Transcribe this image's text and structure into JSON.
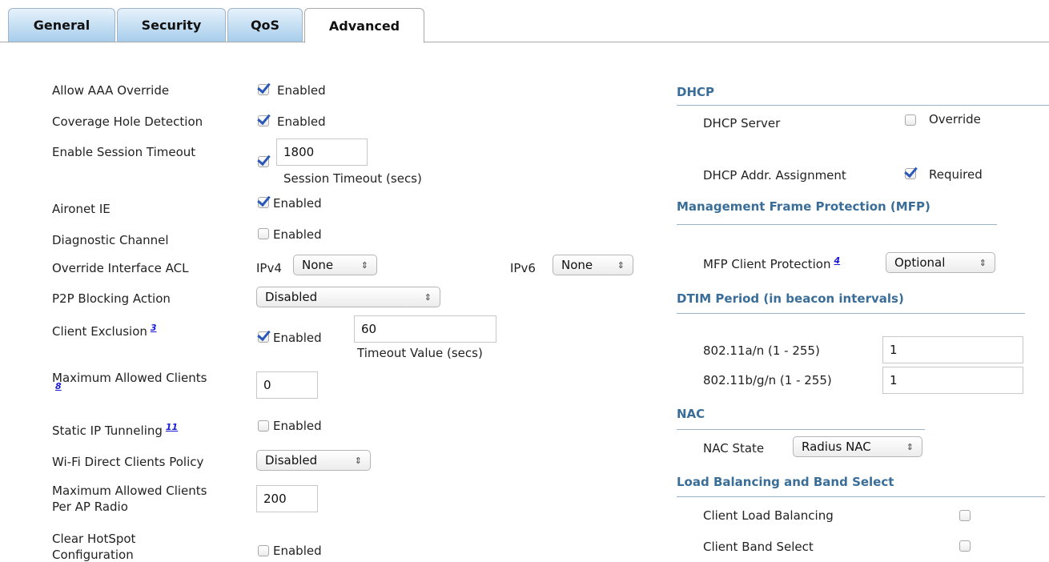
{
  "tabs": [
    {
      "label": "General"
    },
    {
      "label": "Security"
    },
    {
      "label": "QoS"
    },
    {
      "label": "Advanced"
    }
  ],
  "left": {
    "allow_aaa": {
      "label": "Allow AAA Override",
      "checked": true,
      "text": "Enabled"
    },
    "coverage_hole": {
      "label": "Coverage Hole Detection",
      "checked": true,
      "text": "Enabled"
    },
    "session_timeout": {
      "label": "Enable Session Timeout",
      "checked": true,
      "value": "1800",
      "caption": "Session Timeout (secs)"
    },
    "aironet": {
      "label": "Aironet IE",
      "checked": true,
      "text": "Enabled"
    },
    "diagnostic": {
      "label": "Diagnostic Channel",
      "checked": false,
      "text": "Enabled"
    },
    "override_acl": {
      "label": "Override Interface ACL",
      "ipv4_label": "IPv4",
      "ipv4_value": "None",
      "ipv6_label": "IPv6",
      "ipv6_value": "None"
    },
    "p2p": {
      "label": "P2P Blocking Action",
      "value": "Disabled"
    },
    "client_exclusion": {
      "label": "Client Exclusion",
      "footnote": "3",
      "checked": true,
      "text": "Enabled",
      "value": "60",
      "caption": "Timeout Value (secs)"
    },
    "max_clients": {
      "label_line1": "Maximum Allowed Clients",
      "footnote": "8",
      "value": "0"
    },
    "static_ip": {
      "label": "Static IP Tunneling",
      "footnote": "11",
      "checked": false,
      "text": "Enabled"
    },
    "wifi_direct": {
      "label": "Wi-Fi Direct Clients Policy",
      "value": "Disabled"
    },
    "max_per_radio": {
      "label_line1": "Maximum Allowed Clients",
      "label_line2": "Per AP Radio",
      "value": "200"
    },
    "hotspot": {
      "label_line1": "Clear HotSpot",
      "label_line2": "Configuration",
      "checked": false,
      "text": "Enabled"
    }
  },
  "right": {
    "dhcp": {
      "title": "DHCP",
      "server_label": "DHCP Server",
      "server_checked": false,
      "server_text": "Override",
      "assign_label": "DHCP Addr. Assignment",
      "assign_checked": true,
      "assign_text": "Required"
    },
    "mfp": {
      "title": "Management Frame Protection (MFP)",
      "label": "MFP Client Protection",
      "footnote": "4",
      "value": "Optional"
    },
    "dtim": {
      "title": "DTIM Period (in beacon intervals)",
      "a_label": "802.11a/n (1 - 255)",
      "a_value": "1",
      "bg_label": "802.11b/g/n (1 - 255)",
      "bg_value": "1"
    },
    "nac": {
      "title": "NAC",
      "label": "NAC State",
      "value": "Radius NAC"
    },
    "lb": {
      "title": "Load Balancing and Band Select",
      "balancing_label": "Client Load Balancing",
      "balancing_checked": false,
      "band_label": "Client Band Select",
      "band_checked": false
    }
  }
}
